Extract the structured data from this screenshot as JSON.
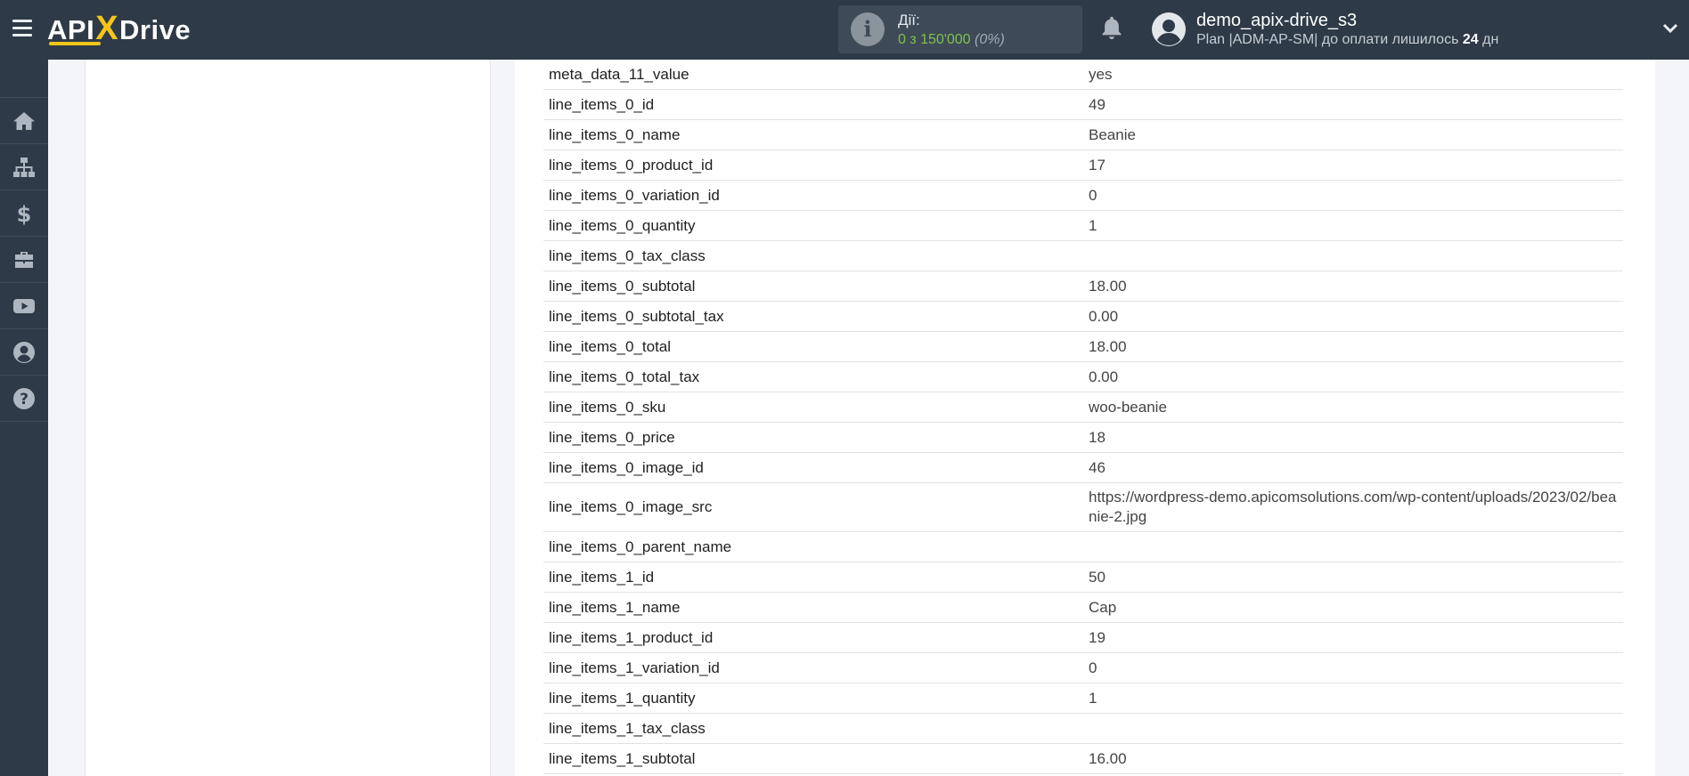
{
  "header": {
    "logo_left": "API",
    "logo_x": "X",
    "logo_right": "Drive",
    "actions_label": "Дії:",
    "actions_value": "0 з 150'000",
    "actions_percent": "(0%)",
    "user_name": "demo_apix-drive_s3",
    "plan_text": "Plan |ADM-AP-SM| до оплати лишилось",
    "plan_days": "24",
    "plan_days_unit": "дн"
  },
  "icons": {
    "menu": "hamburger-menu-icon",
    "info": "info-icon",
    "bell": "bell-icon",
    "avatar": "user-avatar-icon",
    "chevron": "chevron-down-icon"
  },
  "sidebar": {
    "items": [
      {
        "name": "home",
        "icon": "home-icon"
      },
      {
        "name": "connections",
        "icon": "sitemap-icon"
      },
      {
        "name": "billing",
        "icon": "dollar-icon"
      },
      {
        "name": "tools",
        "icon": "briefcase-icon"
      },
      {
        "name": "video",
        "icon": "youtube-icon"
      },
      {
        "name": "account",
        "icon": "user-circle-icon"
      },
      {
        "name": "help",
        "icon": "question-circle-icon"
      }
    ]
  },
  "rows": [
    {
      "key": "meta_data_11_value",
      "value": "yes"
    },
    {
      "key": "line_items_0_id",
      "value": "49"
    },
    {
      "key": "line_items_0_name",
      "value": "Beanie"
    },
    {
      "key": "line_items_0_product_id",
      "value": "17"
    },
    {
      "key": "line_items_0_variation_id",
      "value": "0"
    },
    {
      "key": "line_items_0_quantity",
      "value": "1"
    },
    {
      "key": "line_items_0_tax_class",
      "value": ""
    },
    {
      "key": "line_items_0_subtotal",
      "value": "18.00"
    },
    {
      "key": "line_items_0_subtotal_tax",
      "value": "0.00"
    },
    {
      "key": "line_items_0_total",
      "value": "18.00"
    },
    {
      "key": "line_items_0_total_tax",
      "value": "0.00"
    },
    {
      "key": "line_items_0_sku",
      "value": "woo-beanie"
    },
    {
      "key": "line_items_0_price",
      "value": "18"
    },
    {
      "key": "line_items_0_image_id",
      "value": "46"
    },
    {
      "key": "line_items_0_image_src",
      "value": "https://wordpress-demo.apicomsolutions.com/wp-content/uploads/2023/02/beanie-2.jpg",
      "tall": true
    },
    {
      "key": "line_items_0_parent_name",
      "value": ""
    },
    {
      "key": "line_items_1_id",
      "value": "50"
    },
    {
      "key": "line_items_1_name",
      "value": "Cap"
    },
    {
      "key": "line_items_1_product_id",
      "value": "19"
    },
    {
      "key": "line_items_1_variation_id",
      "value": "0"
    },
    {
      "key": "line_items_1_quantity",
      "value": "1"
    },
    {
      "key": "line_items_1_tax_class",
      "value": ""
    },
    {
      "key": "line_items_1_subtotal",
      "value": "16.00"
    }
  ]
}
